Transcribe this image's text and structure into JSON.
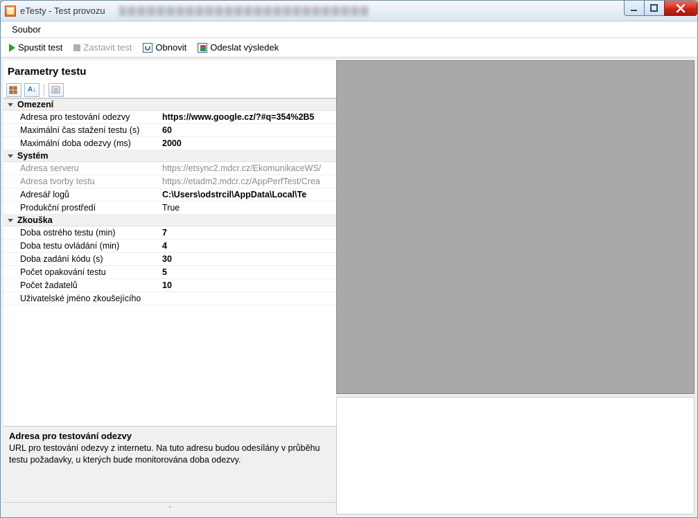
{
  "window": {
    "title": "eTesty - Test provozu"
  },
  "menu": {
    "file": "Soubor"
  },
  "toolbar": {
    "start": "Spustit test",
    "stop": "Zastavit test",
    "refresh": "Obnovit",
    "send": "Odeslat výsledek"
  },
  "panel": {
    "title": "Parametry testu"
  },
  "categories": {
    "omezeni": "Omezení",
    "system": "Systém",
    "zkouska": "Zkouška"
  },
  "props": {
    "adresaOdezvy": {
      "label": "Adresa pro testování odezvy",
      "value": "https://www.google.cz/?#q=354%2B5"
    },
    "maxCas": {
      "label": "Maximální čas stažení testu (s)",
      "value": "60"
    },
    "maxOdezva": {
      "label": "Maximální doba odezvy (ms)",
      "value": "2000"
    },
    "adresaServeru": {
      "label": "Adresa serveru",
      "value": "https://etsync2.mdcr.cz/EkomunikaceWS/"
    },
    "adresaTvorby": {
      "label": "Adresa tvorby testu",
      "value": "https://etadm2.mdcr.cz/AppPerfTest/Crea"
    },
    "adresarLogu": {
      "label": "Adresář logů",
      "value": "C:\\Users\\odstrcil\\AppData\\Local\\Te"
    },
    "produkcni": {
      "label": "Produkční prostředí",
      "value": "True"
    },
    "dobaOstreho": {
      "label": "Doba ostrého testu (min)",
      "value": "7"
    },
    "dobaOvladani": {
      "label": "Doba testu ovládání (min)",
      "value": "4"
    },
    "dobaKodu": {
      "label": "Doba zadání kódu (s)",
      "value": "30"
    },
    "pocetOpak": {
      "label": "Počet opakování testu",
      "value": "5"
    },
    "pocetZad": {
      "label": "Počet žadatelů",
      "value": "10"
    },
    "uzivJmeno": {
      "label": "Uživatelské jméno zkoušejícího",
      "value": ""
    }
  },
  "description": {
    "title": "Adresa pro testování odezvy",
    "body": "URL pro testování odezvy z internetu. Na tuto adresu budou odesílány v průběhu testu požadavky, u kterých bude monitorována doba odezvy."
  },
  "status": "-"
}
